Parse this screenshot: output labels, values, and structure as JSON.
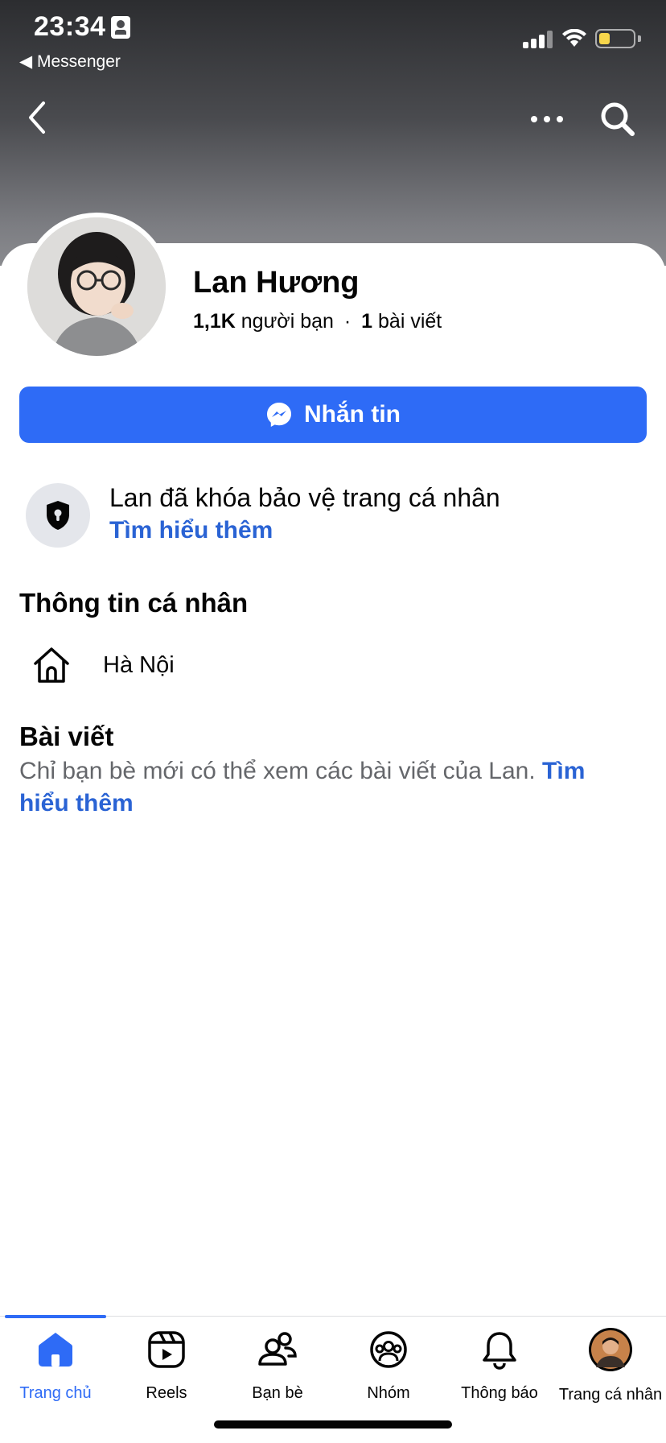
{
  "status_bar": {
    "time": "23:34",
    "back_app": "◀ Messenger"
  },
  "profile": {
    "name": "Lan Hương",
    "friends_count": "1,1K",
    "friends_label": "người bạn",
    "separator": "·",
    "posts_count": "1",
    "posts_label": "bài viết"
  },
  "actions": {
    "message_label": "Nhắn tin"
  },
  "lock_notice": {
    "title": "Lan đã khóa bảo vệ trang cá nhân",
    "link": "Tìm hiểu thêm"
  },
  "about": {
    "title": "Thông tin cá nhân",
    "location": "Hà Nội"
  },
  "posts": {
    "title": "Bài viết",
    "description": "Chỉ bạn bè mới có thể xem các bài viết của Lan.",
    "link": "Tìm hiểu thêm"
  },
  "tabbar": {
    "items": [
      {
        "label": "Trang chủ",
        "icon": "home-icon",
        "active": true
      },
      {
        "label": "Reels",
        "icon": "reels-icon"
      },
      {
        "label": "Bạn bè",
        "icon": "friends-icon"
      },
      {
        "label": "Nhóm",
        "icon": "groups-icon"
      },
      {
        "label": "Thông báo",
        "icon": "bell-icon"
      },
      {
        "label": "Trang cá nhân",
        "icon": "profile-avatar"
      }
    ]
  },
  "colors": {
    "accent": "#2e6bf6",
    "link": "#2a63d4",
    "muted_text": "#65676b"
  }
}
